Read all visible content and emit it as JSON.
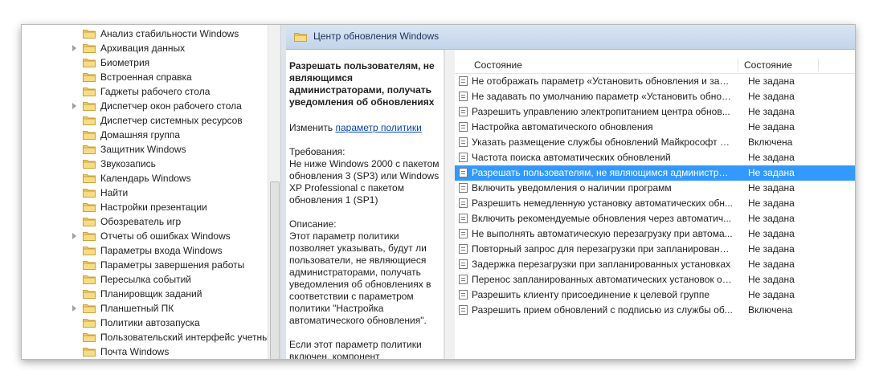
{
  "tree": {
    "items": [
      {
        "label": "Анализ стабильности Windows",
        "expander": false
      },
      {
        "label": "Архивация данных",
        "expander": true
      },
      {
        "label": "Биометрия",
        "expander": false
      },
      {
        "label": "Встроенная справка",
        "expander": false
      },
      {
        "label": "Гаджеты рабочего стола",
        "expander": false
      },
      {
        "label": "Диспетчер окон рабочего стола",
        "expander": true
      },
      {
        "label": "Диспетчер системных ресурсов",
        "expander": false
      },
      {
        "label": "Домашняя группа",
        "expander": false
      },
      {
        "label": "Защитник Windows",
        "expander": false
      },
      {
        "label": "Звукозапись",
        "expander": false
      },
      {
        "label": "Календарь Windows",
        "expander": false
      },
      {
        "label": "Найти",
        "expander": false
      },
      {
        "label": "Настройки презентации",
        "expander": false
      },
      {
        "label": "Обозреватель игр",
        "expander": false
      },
      {
        "label": "Отчеты об ошибках Windows",
        "expander": true
      },
      {
        "label": "Параметры входа Windows",
        "expander": false
      },
      {
        "label": "Параметры завершения работы",
        "expander": false
      },
      {
        "label": "Пересылка событий",
        "expander": false
      },
      {
        "label": "Планировщик заданий",
        "expander": false
      },
      {
        "label": "Планшетный ПК",
        "expander": true
      },
      {
        "label": "Политики автозапуска",
        "expander": false
      },
      {
        "label": "Пользовательский интерфейс учетны",
        "expander": false
      },
      {
        "label": "Почта Windows",
        "expander": false
      }
    ]
  },
  "header": {
    "title": "Центр обновления Windows"
  },
  "description": {
    "title": "Разрешать пользователям, не являющимся администраторами, получать уведомления об обновлениях",
    "edit_prefix": "Изменить ",
    "edit_link": "параметр политики",
    "requirements_label": "Требования:",
    "requirements_text": "Не ниже Windows 2000 с пакетом обновления 3 (SP3) или Windows XP Professional с пакетом обновления 1 (SP1)",
    "description_label": "Описание:",
    "description_text": "Этот параметр политики позволяет указывать, будут ли пользователи, не являющиеся администраторами, получать уведомления об обновлениях в соответствии с параметром политики \"Настройка автоматического обновления\".",
    "extra_text": "Если этот параметр политики включен, компонент"
  },
  "list": {
    "columns": {
      "name": "Состояние",
      "state": "Состояние"
    },
    "rows": [
      {
        "name": "Не отображать параметр «Установить обновления и заве...",
        "state": "Не задана",
        "selected": false
      },
      {
        "name": "Не задавать по умолчанию параметр «Установить обнов...",
        "state": "Не задана",
        "selected": false
      },
      {
        "name": "Разрешить управлению электропитанием центра обнов...",
        "state": "Не задана",
        "selected": false
      },
      {
        "name": "Настройка автоматического обновления",
        "state": "Не задана",
        "selected": false
      },
      {
        "name": "Указать размещение службы обновлений Майкрософт в...",
        "state": "Включена",
        "selected": false
      },
      {
        "name": "Частота поиска автоматических обновлений",
        "state": "Не задана",
        "selected": false
      },
      {
        "name": "Разрешать пользователям, не являющимся администрат...",
        "state": "Не задана",
        "selected": true
      },
      {
        "name": "Включить уведомления о наличии программ",
        "state": "Не задана",
        "selected": false
      },
      {
        "name": "Разрешить немедленную установку автоматических обн...",
        "state": "Не задана",
        "selected": false
      },
      {
        "name": "Включить рекомендуемые обновления через автоматич...",
        "state": "Не задана",
        "selected": false
      },
      {
        "name": "Не выполнять автоматическую перезагрузку при автома...",
        "state": "Не задана",
        "selected": false
      },
      {
        "name": "Повторный запрос для перезагрузки при запланированн...",
        "state": "Не задана",
        "selected": false
      },
      {
        "name": "Задержка перезагрузки при запланированных установках",
        "state": "Не задана",
        "selected": false
      },
      {
        "name": "Перенос запланированных автоматических установок об...",
        "state": "Не задана",
        "selected": false
      },
      {
        "name": "Разрешить клиенту присоединение к целевой группе",
        "state": "Не задана",
        "selected": false
      },
      {
        "name": "Разрешить прием обновлений с подписью из службы об...",
        "state": "Включена",
        "selected": false
      }
    ]
  },
  "colors": {
    "selection": "#3399ff",
    "header_bg": "#c3d4ea",
    "folder": "#f2cf6a"
  }
}
